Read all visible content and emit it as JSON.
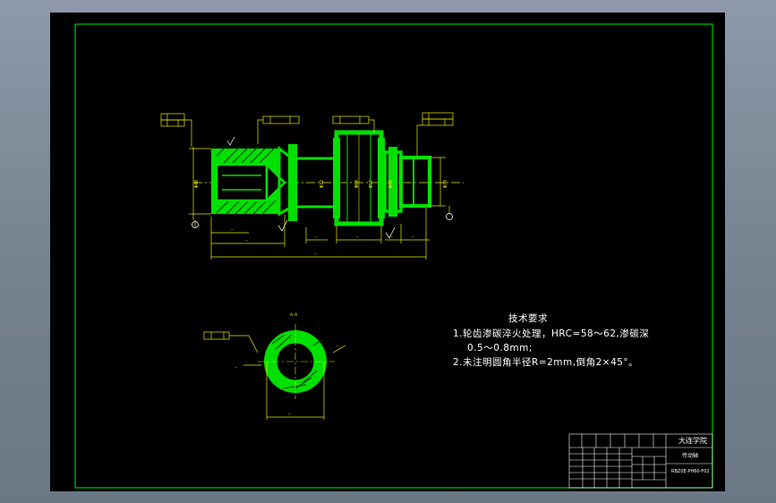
{
  "tech_requirements": {
    "title": "技术要求",
    "line1": "1.轮齿渗碳淬火处理，HRC=58～62,渗碳深",
    "line2": "0.5～0.8mm;",
    "line3": "2.未注明圆角半径R=2mm,倒角2×45°。"
  },
  "title_block": {
    "school": "大连学院",
    "part_name": "传动轴",
    "drawing_no": "RBZ0E-PH60-F02"
  },
  "colors": {
    "border": "#00c800",
    "part": "#00e000",
    "dimension": "#e8e800",
    "text": "#ffffff",
    "background": "#000000"
  }
}
